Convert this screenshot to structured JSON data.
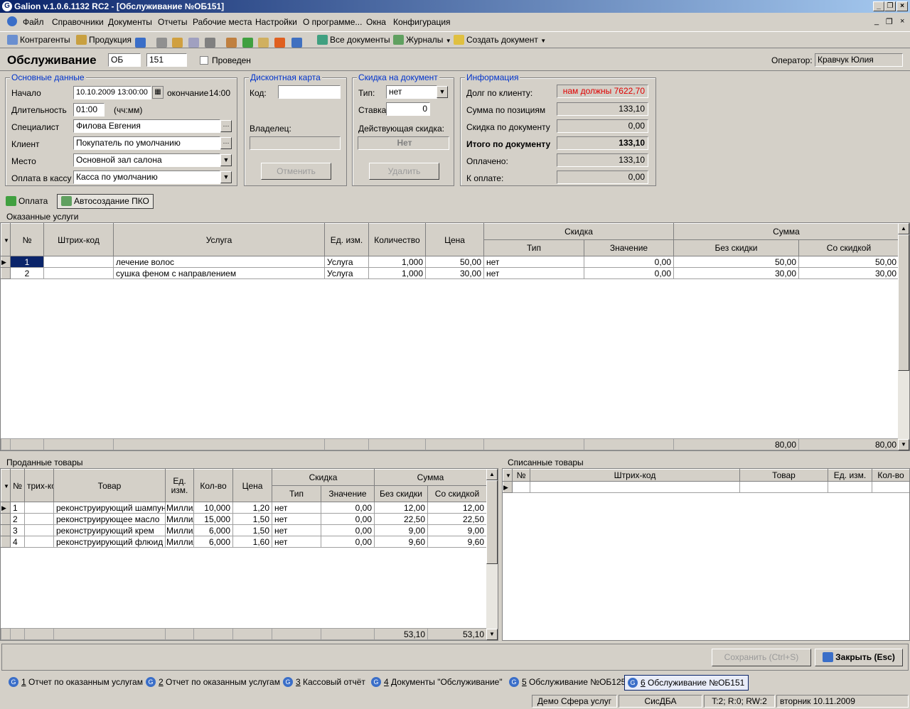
{
  "window": {
    "title": "Galion  v.1.0.6.1132 RC2 - [Обслуживание №ОБ151]"
  },
  "menu": [
    "Файл",
    "Справочники",
    "Документы",
    "Отчеты",
    "Рабочие места",
    "Настройки",
    "О программе...",
    "Окна",
    "Конфигурация"
  ],
  "toolbar": {
    "contractors": "Контрагенты",
    "products": "Продукция",
    "all_docs": "Все документы",
    "journals": "Журналы",
    "create_doc": "Создать документ"
  },
  "header": {
    "title": "Обслуживание",
    "series": "ОБ",
    "number": "151",
    "posted": "Проведен",
    "operator_label": "Оператор:",
    "operator": "Кравчук Юлия"
  },
  "main_data": {
    "legend": "Основные данные",
    "start_label": "Начало",
    "start_value": "10.10.2009 13:00:00",
    "end_label": "окончание",
    "end_value": "14:00",
    "duration_label": "Длительность",
    "duration_value": "01:00",
    "duration_hint": "(чч:мм)",
    "specialist_label": "Специалист",
    "specialist_value": "Филова Евгения",
    "client_label": "Клиент",
    "client_value": "Покупатель по умолчанию",
    "place_label": "Место",
    "place_value": "Основной зал салона",
    "cashbox_label": "Оплата в кассу",
    "cashbox_value": "Касса по умолчанию"
  },
  "discount_card": {
    "legend": "Дисконтная карта",
    "code_label": "Код:",
    "owner_label": "Владелец:",
    "cancel_btn": "Отменить"
  },
  "doc_discount": {
    "legend": "Скидка на документ",
    "type_label": "Тип:",
    "type_value": "нет",
    "rate_label": "Ставка:",
    "rate_value": "0",
    "current_label": "Действующая скидка:",
    "current_value": "Нет",
    "delete_btn": "Удалить"
  },
  "info": {
    "legend": "Информация",
    "debt_label": "Долг по клиенту:",
    "debt_value": "нам должны 7622,70",
    "sum_pos_label": "Сумма по позициям",
    "sum_pos_value": "133,10",
    "discount_label": "Скидка по документу",
    "discount_value": "0,00",
    "total_label": "Итого по документу",
    "total_value": "133,10",
    "paid_label": "Оплачено:",
    "paid_value": "133,10",
    "topay_label": "К оплате:",
    "topay_value": "0,00"
  },
  "actions": {
    "pay": "Оплата",
    "auto_pko": "Автосоздание ПКО"
  },
  "services": {
    "caption": "Оказанные услуги",
    "headers": {
      "num": "№",
      "barcode": "Штрих-код",
      "service": "Услуга",
      "unit": "Ед. изм.",
      "qty": "Количество",
      "price": "Цена",
      "discount": "Скидка",
      "disc_type": "Тип",
      "disc_value": "Значение",
      "sum": "Сумма",
      "sum_nodisc": "Без скидки",
      "sum_disc": "Со скидкой"
    },
    "rows": [
      {
        "num": "1",
        "barcode": "",
        "service": "лечение волос",
        "unit": "Услуга",
        "qty": "1,000",
        "price": "50,00",
        "disc_type": "нет",
        "disc_value": "0,00",
        "sum_nodisc": "50,00",
        "sum_disc": "50,00"
      },
      {
        "num": "2",
        "barcode": "",
        "service": "сушка феном с направлением",
        "unit": "Услуга",
        "qty": "1,000",
        "price": "30,00",
        "disc_type": "нет",
        "disc_value": "0,00",
        "sum_nodisc": "30,00",
        "sum_disc": "30,00"
      }
    ],
    "footer": {
      "sum_nodisc": "80,00",
      "sum_disc": "80,00"
    }
  },
  "sold": {
    "caption": "Проданные товары",
    "headers": {
      "num": "№",
      "barcode": "трих-ко",
      "product": "Товар",
      "unit": "Ед. изм.",
      "qty": "Кол-во",
      "price": "Цена",
      "discount": "Скидка",
      "disc_type": "Тип",
      "disc_value": "Значение",
      "sum": "Сумма",
      "sum_nodisc": "Без скидки",
      "sum_disc": "Со скидкой"
    },
    "rows": [
      {
        "num": "1",
        "product": "реконструирующий шампунь",
        "unit": "Миллил",
        "qty": "10,000",
        "price": "1,20",
        "disc_type": "нет",
        "disc_value": "0,00",
        "sum_nodisc": "12,00",
        "sum_disc": "12,00"
      },
      {
        "num": "2",
        "product": "реконструирующее масло",
        "unit": "Миллил",
        "qty": "15,000",
        "price": "1,50",
        "disc_type": "нет",
        "disc_value": "0,00",
        "sum_nodisc": "22,50",
        "sum_disc": "22,50"
      },
      {
        "num": "3",
        "product": "реконструирующий крем",
        "unit": "Миллил",
        "qty": "6,000",
        "price": "1,50",
        "disc_type": "нет",
        "disc_value": "0,00",
        "sum_nodisc": "9,00",
        "sum_disc": "9,00"
      },
      {
        "num": "4",
        "product": "реконструирующий флюид",
        "unit": "Миллил",
        "qty": "6,000",
        "price": "1,60",
        "disc_type": "нет",
        "disc_value": "0,00",
        "sum_nodisc": "9,60",
        "sum_disc": "9,60"
      }
    ],
    "footer": {
      "sum_nodisc": "53,10",
      "sum_disc": "53,10"
    }
  },
  "written_off": {
    "caption": "Списанные товары",
    "headers": {
      "num": "№",
      "barcode": "Штрих-код",
      "product": "Товар",
      "unit": "Ед. изм.",
      "qty": "Кол-во"
    }
  },
  "buttons": {
    "save": "Сохранить (Ctrl+S)",
    "close": "Закрыть (Esc)"
  },
  "taskbar": [
    {
      "n": "1",
      "label": " Отчет по оказанным услугам"
    },
    {
      "n": "2",
      "label": " Отчет по оказанным услугам"
    },
    {
      "n": "3",
      "label": " Кассовый отчёт"
    },
    {
      "n": "4",
      "label": " Документы \"Обслуживание\""
    },
    {
      "n": "5",
      "label": " Обслуживание №ОБ125"
    },
    {
      "n": "6",
      "label": " Обслуживание №ОБ151"
    }
  ],
  "status": {
    "db": "Демо Сфера услуг",
    "user": "СисДБА",
    "counters": "T:2; R:0; RW:2",
    "date": "вторник 10.11.2009"
  }
}
